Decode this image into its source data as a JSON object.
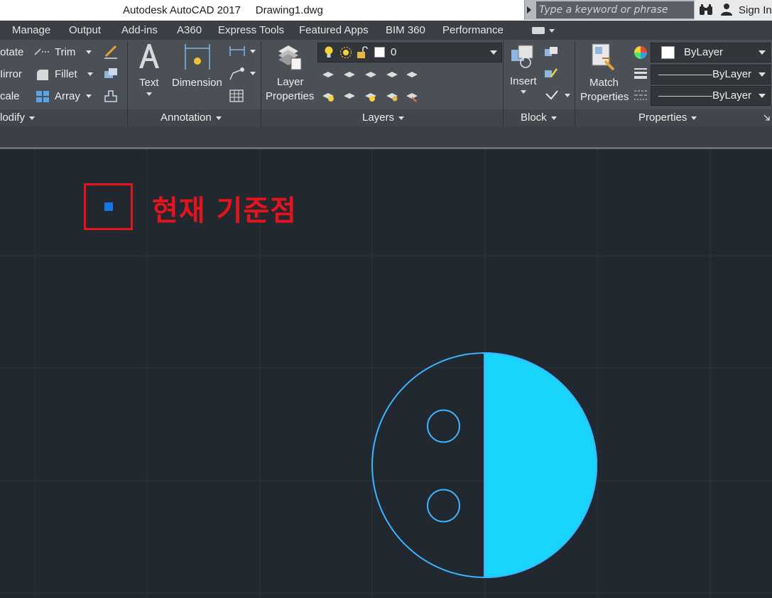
{
  "titlebar": {
    "app_title": "Autodesk AutoCAD 2017",
    "file_title": "Drawing1.dwg",
    "search_placeholder": "Type a keyword or phrase",
    "sign_in": "Sign In"
  },
  "menu": {
    "tabs": [
      "Manage",
      "Output",
      "Add-ins",
      "A360",
      "Express Tools",
      "Featured Apps",
      "BIM 360",
      "Performance"
    ]
  },
  "ribbon": {
    "modify": {
      "rotate": "otate",
      "mirror": "Iirror",
      "scale": "cale",
      "trim": "Trim",
      "fillet": "Fillet",
      "array": "Array",
      "footer": "lodify"
    },
    "annotation": {
      "text": "Text",
      "dimension": "Dimension",
      "footer": "Annotation"
    },
    "layers": {
      "layer_properties_1": "Layer",
      "layer_properties_2": "Properties",
      "current_layer": "0",
      "footer": "Layers"
    },
    "block": {
      "insert": "Insert",
      "footer": "Block"
    },
    "properties": {
      "match_1": "Match",
      "match_2": "Properties",
      "color": "ByLayer",
      "linetype": "ByLayer",
      "lineweight": "ByLayer",
      "footer": "Properties"
    }
  },
  "canvas": {
    "annotation_text": "현재 기준점",
    "colors": {
      "background": "#212830",
      "grid": "#2c3440",
      "outline": "#3cb4ff",
      "fill": "#1ad5fb",
      "annotation": "#e3141e",
      "base_point": "#1577e6"
    }
  }
}
